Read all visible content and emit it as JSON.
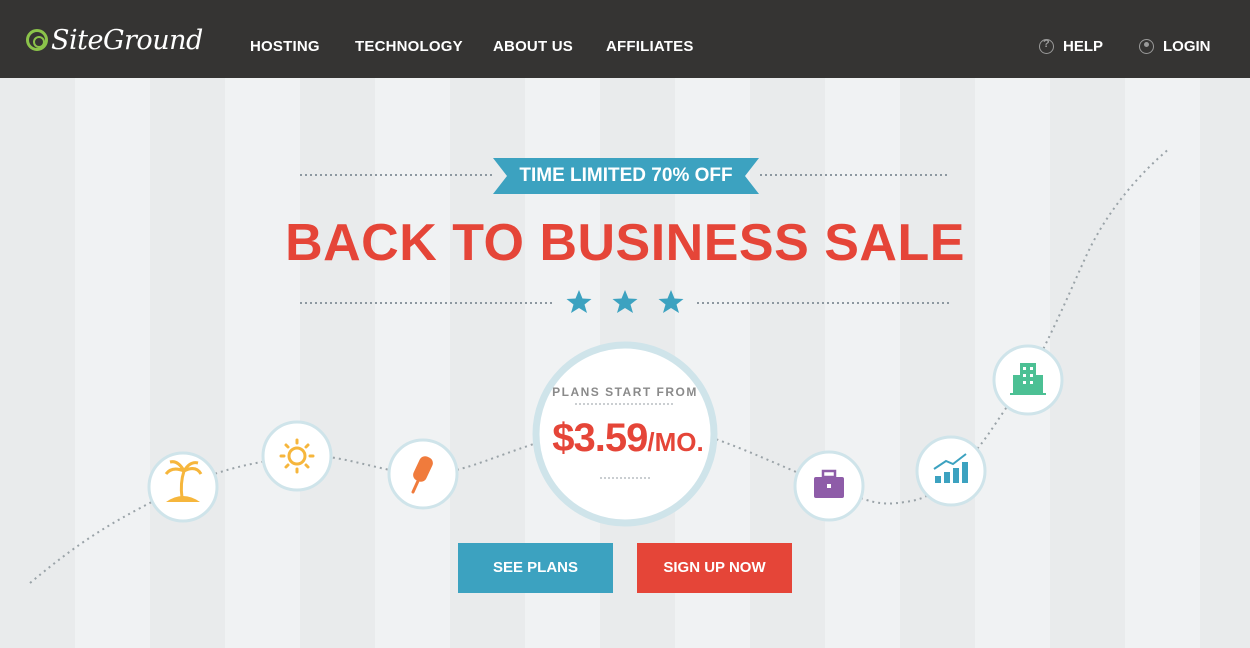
{
  "brand": {
    "name": "SiteGround"
  },
  "nav": {
    "items": [
      {
        "label": "HOSTING"
      },
      {
        "label": "TECHNOLOGY"
      },
      {
        "label": "ABOUT US"
      },
      {
        "label": "AFFILIATES"
      }
    ],
    "help_label": "HELP",
    "login_label": "LOGIN"
  },
  "hero": {
    "ribbon": "TIME LIMITED 70% OFF",
    "headline": "BACK TO BUSINESS SALE",
    "price_caption": "PLANS START FROM",
    "price": "$3.59",
    "price_unit": "/MO.",
    "see_plans_label": "SEE PLANS",
    "sign_up_label": "SIGN UP NOW"
  },
  "colors": {
    "header_bg": "#353433",
    "brand_green": "#8bc34a",
    "accent_red": "#e54538",
    "accent_blue": "#3ca2c0"
  },
  "icons": [
    "palm-tree-icon",
    "sun-icon",
    "popsicle-icon",
    "briefcase-icon",
    "growth-chart-icon",
    "office-building-icon",
    "star-icon"
  ]
}
